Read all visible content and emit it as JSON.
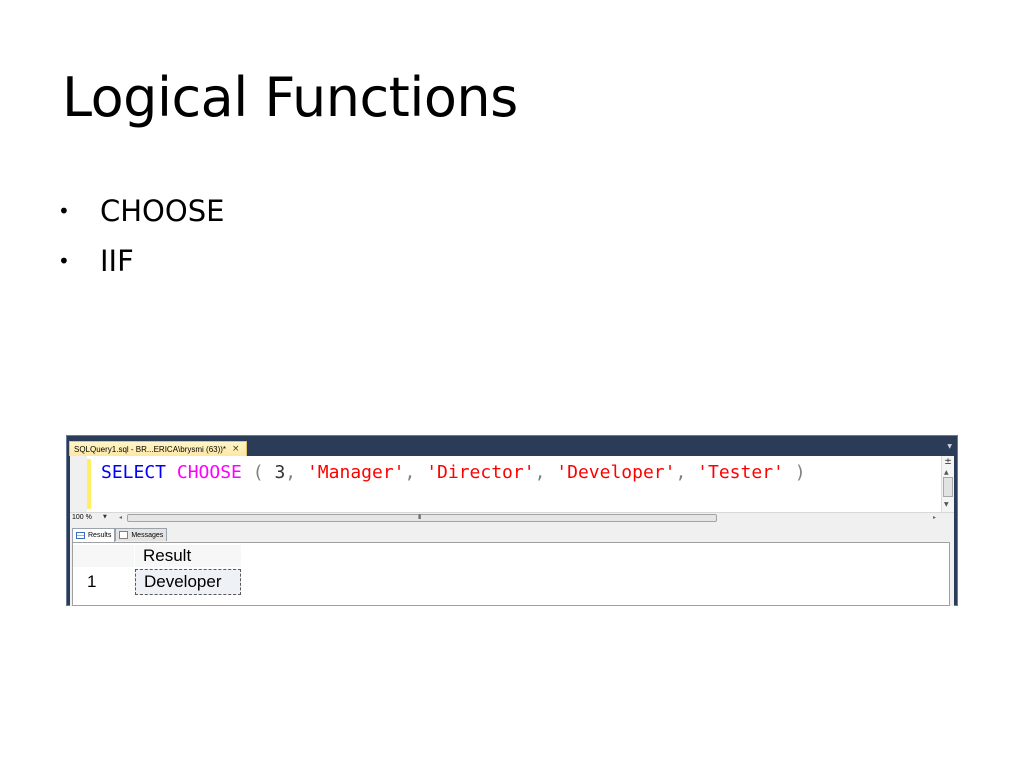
{
  "slide": {
    "title": "Logical Functions",
    "bullets": [
      "CHOOSE",
      "IIF"
    ]
  },
  "ssms": {
    "document_tab": {
      "label": "SQLQuery1.sql - BR...ERICA\\brysmi (63))*",
      "close": "×"
    },
    "query": {
      "select": "SELECT",
      "function": "CHOOSE",
      "open_paren": "(",
      "index": "3",
      "comma": ",",
      "args": [
        "'Manager'",
        "'Director'",
        "'Developer'",
        "'Tester'"
      ],
      "close_paren": ")"
    },
    "zoom": "100 %",
    "h_scroll_grip": "III",
    "result_tabs": [
      "Results",
      "Messages"
    ],
    "grid": {
      "columns": [
        "Result"
      ],
      "rows": [
        {
          "number": "1",
          "cells": [
            "Developer"
          ]
        }
      ]
    },
    "colors": {
      "keyword": "#0000ff",
      "function": "#ff00ff",
      "string": "#ff0000",
      "frame": "#2b3c59"
    }
  }
}
